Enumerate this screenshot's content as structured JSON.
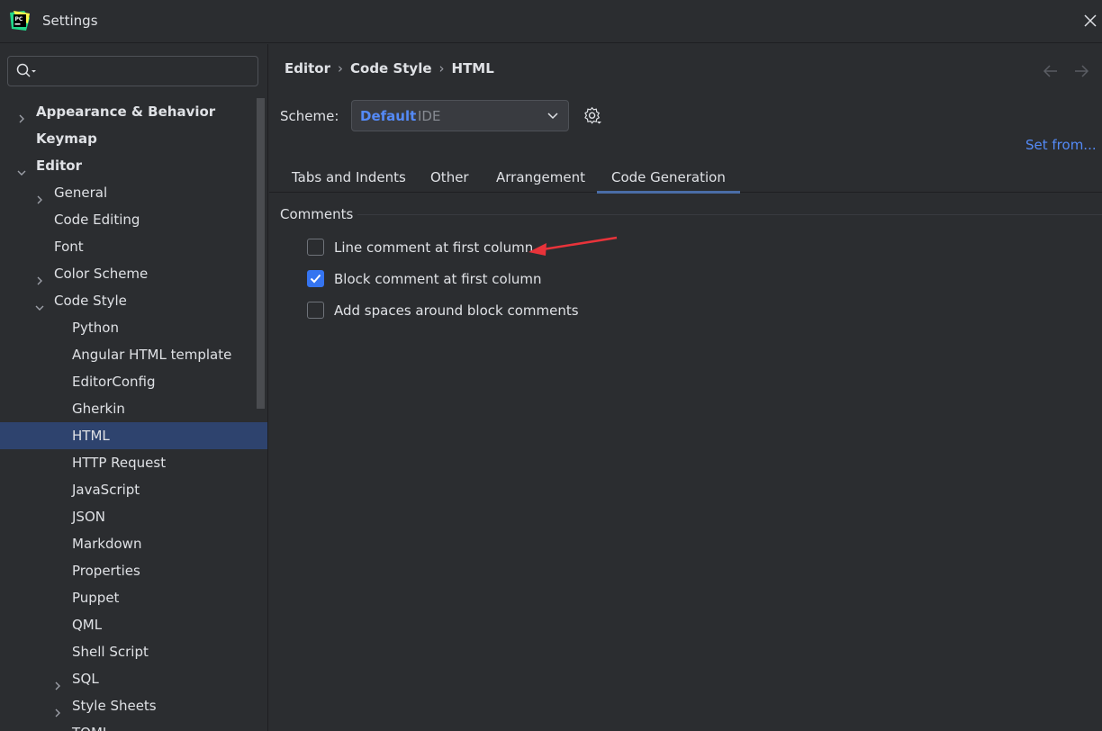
{
  "window": {
    "title": "Settings"
  },
  "sidebar": {
    "search_placeholder": "",
    "items": [
      {
        "label": "Appearance & Behavior",
        "level": 0,
        "bold": true,
        "chevron": "right",
        "selected": false
      },
      {
        "label": "Keymap",
        "level": 0,
        "bold": true,
        "chevron": "none",
        "selected": false
      },
      {
        "label": "Editor",
        "level": 0,
        "bold": true,
        "chevron": "down",
        "selected": false
      },
      {
        "label": "General",
        "level": 1,
        "bold": false,
        "chevron": "right",
        "selected": false
      },
      {
        "label": "Code Editing",
        "level": 1,
        "bold": false,
        "chevron": "none",
        "selected": false
      },
      {
        "label": "Font",
        "level": 1,
        "bold": false,
        "chevron": "none",
        "selected": false
      },
      {
        "label": "Color Scheme",
        "level": 1,
        "bold": false,
        "chevron": "right",
        "selected": false
      },
      {
        "label": "Code Style",
        "level": 1,
        "bold": false,
        "chevron": "down",
        "selected": false
      },
      {
        "label": "Python",
        "level": 2,
        "bold": false,
        "chevron": "none",
        "selected": false
      },
      {
        "label": "Angular HTML template",
        "level": 2,
        "bold": false,
        "chevron": "none",
        "selected": false
      },
      {
        "label": "EditorConfig",
        "level": 2,
        "bold": false,
        "chevron": "none",
        "selected": false
      },
      {
        "label": "Gherkin",
        "level": 2,
        "bold": false,
        "chevron": "none",
        "selected": false
      },
      {
        "label": "HTML",
        "level": 2,
        "bold": false,
        "chevron": "none",
        "selected": true
      },
      {
        "label": "HTTP Request",
        "level": 2,
        "bold": false,
        "chevron": "none",
        "selected": false
      },
      {
        "label": "JavaScript",
        "level": 2,
        "bold": false,
        "chevron": "none",
        "selected": false
      },
      {
        "label": "JSON",
        "level": 2,
        "bold": false,
        "chevron": "none",
        "selected": false
      },
      {
        "label": "Markdown",
        "level": 2,
        "bold": false,
        "chevron": "none",
        "selected": false
      },
      {
        "label": "Properties",
        "level": 2,
        "bold": false,
        "chevron": "none",
        "selected": false
      },
      {
        "label": "Puppet",
        "level": 2,
        "bold": false,
        "chevron": "none",
        "selected": false
      },
      {
        "label": "QML",
        "level": 2,
        "bold": false,
        "chevron": "none",
        "selected": false
      },
      {
        "label": "Shell Script",
        "level": 2,
        "bold": false,
        "chevron": "none",
        "selected": false
      },
      {
        "label": "SQL",
        "level": 2,
        "bold": false,
        "chevron": "right",
        "selected": false
      },
      {
        "label": "Style Sheets",
        "level": 2,
        "bold": false,
        "chevron": "right",
        "selected": false
      },
      {
        "label": "TOML",
        "level": 2,
        "bold": false,
        "chevron": "none",
        "selected": false
      }
    ]
  },
  "breadcrumb": [
    "Editor",
    "Code Style",
    "HTML"
  ],
  "scheme": {
    "label": "Scheme:",
    "name": "Default",
    "kind": "IDE",
    "set_from": "Set from..."
  },
  "tabs": [
    {
      "label": "Tabs and Indents",
      "active": false
    },
    {
      "label": "Other",
      "active": false
    },
    {
      "label": "Arrangement",
      "active": false
    },
    {
      "label": "Code Generation",
      "active": true
    }
  ],
  "comments": {
    "title": "Comments",
    "options": [
      {
        "label": "Line comment at first column",
        "checked": false
      },
      {
        "label": "Block comment at first column",
        "checked": true
      },
      {
        "label": "Add spaces around block comments",
        "checked": false
      }
    ]
  },
  "colors": {
    "accent": "#3574f0",
    "link": "#548af7",
    "selection": "#2e436e",
    "annotation": "#e8333a"
  },
  "icons": {
    "logo": "pycharm-logo",
    "close": "close-icon",
    "search": "search-icon",
    "back": "arrow-left-icon",
    "forward": "arrow-right-icon",
    "gear": "gear-icon"
  }
}
